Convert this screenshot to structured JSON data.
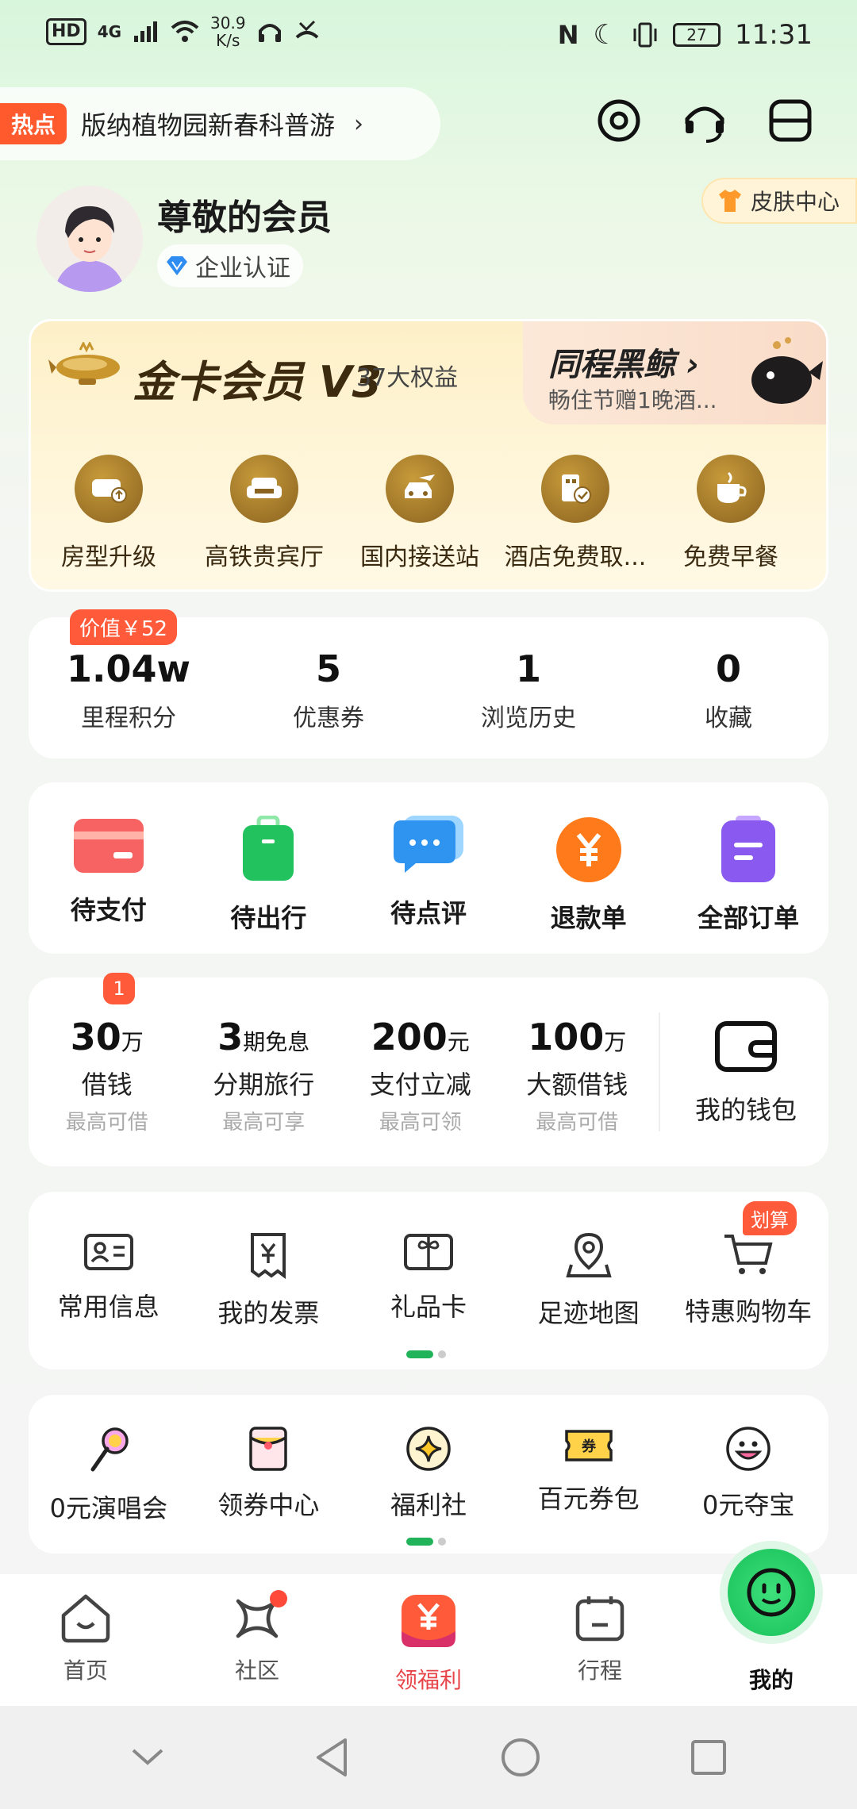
{
  "status_bar": {
    "hd": "HD",
    "network": "4G",
    "speed_value": "30.9",
    "speed_unit": "K/s",
    "battery": "27",
    "time": "11:31"
  },
  "hot": {
    "tag": "热点",
    "text": "版纳植物园新春科普游",
    "arrow": "›"
  },
  "profile": {
    "name": "尊敬的会员",
    "badge": "企业认证",
    "skin_center": "皮肤中心"
  },
  "gold_card": {
    "title": "金卡会员 V3",
    "subtitle": "37大权益",
    "black_whale_title": "同程黑鲸 ›",
    "black_whale_sub": "畅住节赠1晚酒...",
    "benefits": [
      {
        "label": "房型升级",
        "icon": "room-upgrade-icon"
      },
      {
        "label": "高铁贵宾厅",
        "icon": "sofa-icon"
      },
      {
        "label": "国内接送站",
        "icon": "car-plane-icon"
      },
      {
        "label": "酒店免费取...",
        "icon": "hotel-check-icon"
      },
      {
        "label": "免费早餐",
        "icon": "coffee-icon"
      }
    ]
  },
  "stats": {
    "value_badge": "价值￥52",
    "items": [
      {
        "value": "1.04w",
        "label": "里程积分"
      },
      {
        "value": "5",
        "label": "优惠券"
      },
      {
        "value": "1",
        "label": "浏览历史"
      },
      {
        "value": "0",
        "label": "收藏"
      }
    ]
  },
  "orders": [
    {
      "label": "待支付",
      "icon": "card-icon",
      "color": "#f25a5a"
    },
    {
      "label": "待出行",
      "icon": "luggage-icon",
      "color": "#22c35e"
    },
    {
      "label": "待点评",
      "icon": "chat-icon",
      "color": "#3a9bf0"
    },
    {
      "label": "退款单",
      "icon": "yen-icon",
      "color": "#ff7a1a"
    },
    {
      "label": "全部订单",
      "icon": "list-icon",
      "color": "#8a5af0"
    }
  ],
  "finance": {
    "badge": "1",
    "items": [
      {
        "num": "30",
        "unit": "万",
        "label": "借钱",
        "sub": "最高可借"
      },
      {
        "num": "3",
        "unit": "期免息",
        "label": "分期旅行",
        "sub": "最高可享"
      },
      {
        "num": "200",
        "unit": "元",
        "label": "支付立减",
        "sub": "最高可领"
      },
      {
        "num": "100",
        "unit": "万",
        "label": "大额借钱",
        "sub": "最高可借"
      }
    ],
    "wallet_label": "我的钱包"
  },
  "tools": {
    "deal_badge": "划算",
    "items": [
      {
        "label": "常用信息",
        "icon": "id-card-icon"
      },
      {
        "label": "我的发票",
        "icon": "invoice-icon"
      },
      {
        "label": "礼品卡",
        "icon": "gift-card-icon"
      },
      {
        "label": "足迹地图",
        "icon": "map-pin-icon"
      },
      {
        "label": "特惠购物车",
        "icon": "cart-icon"
      }
    ]
  },
  "welfare": [
    {
      "label": "0元演唱会",
      "icon": "microphone-icon"
    },
    {
      "label": "领券中心",
      "icon": "coupon-envelope-icon"
    },
    {
      "label": "福利社",
      "icon": "sparkle-icon"
    },
    {
      "label": "百元券包",
      "icon": "ticket-icon"
    },
    {
      "label": "0元夺宝",
      "icon": "smile-icon"
    }
  ],
  "tabs": [
    {
      "label": "首页",
      "icon": "home-icon"
    },
    {
      "label": "社区",
      "icon": "community-icon"
    },
    {
      "label": "领福利",
      "icon": "welfare-icon"
    },
    {
      "label": "行程",
      "icon": "calendar-icon"
    },
    {
      "label": "我的",
      "icon": "mine-icon"
    }
  ]
}
